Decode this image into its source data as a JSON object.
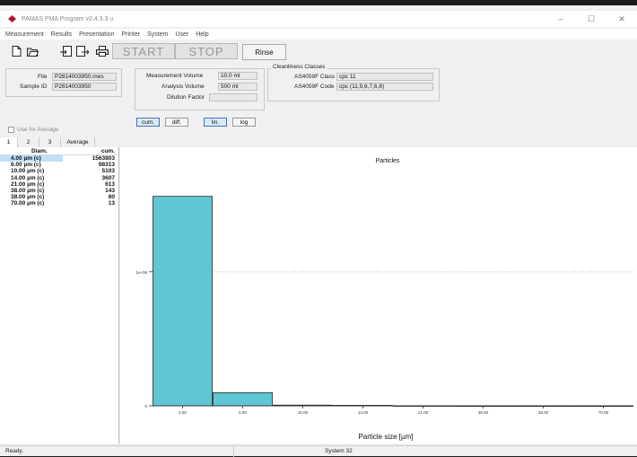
{
  "window": {
    "title": "PAMAS PMA Program v2.4.3.3 u",
    "controls": [
      "–",
      "☐",
      "✕"
    ]
  },
  "menu": [
    "Measurement",
    "Results",
    "Presentation",
    "Printer",
    "System",
    "User",
    "Help"
  ],
  "toolbar": {
    "icons": [
      "new-document-icon",
      "open-folder-icon",
      "export-icon",
      "import-icon",
      "print-icon"
    ],
    "start_label": "START",
    "stop_label": "STOP",
    "rinse_label": "Rinse"
  },
  "info": {
    "file_label": "File",
    "file_value": "P2814003950.mes",
    "sample_label": "Sample ID",
    "sample_value": "P2814003950",
    "meas_volume_label": "Measurement Volume",
    "meas_volume_value": "10.0 ml",
    "analysis_volume_label": "Analysis Volume",
    "analysis_volume_value": "500 ml",
    "dilution_label": "Dilution Factor",
    "dilution_value": "",
    "cleanliness_label": "Cleanliness Classes",
    "as_class_label": "AS4059F Class",
    "as_class_value": "cpc 11",
    "as_code_label": "AS4059F Code",
    "as_code_value": "cpc (11,9,6,7,6,8)",
    "buttons": {
      "cum": "cum.",
      "diff": "diff.",
      "lin": "lin.",
      "log": "log"
    },
    "use_average_label": "Use for Average"
  },
  "tabs": [
    "1",
    "2",
    "3",
    "Average"
  ],
  "table": {
    "headers": [
      "Diam.",
      "cum."
    ],
    "rows": [
      [
        "4.00 µm (c)",
        "1563803"
      ],
      [
        "6.00 µm (c)",
        "98313"
      ],
      [
        "10.00 µm (c)",
        "5103"
      ],
      [
        "14.00 µm (c)",
        "3607"
      ],
      [
        "21.00 µm (c)",
        "613"
      ],
      [
        "38.00 µm (c)",
        "143"
      ],
      [
        "38.00 µm (c)",
        "80"
      ],
      [
        "70.00 µm (c)",
        "13"
      ]
    ]
  },
  "chart_data": {
    "type": "bar",
    "title": "Particles",
    "xlabel": "Particle size [µm]",
    "ylabel": "",
    "categories": [
      "4.00",
      "6.00",
      "10.00",
      "14.00",
      "21.00",
      "38.00",
      "38.00",
      "70.00"
    ],
    "values": [
      1563803,
      98313,
      5103,
      3607,
      613,
      143,
      80,
      13
    ],
    "ylim": [
      0,
      1850000
    ],
    "ytick_labels": [
      {
        "value": 0,
        "label": "0"
      },
      {
        "value": 1000000,
        "label": "1e+06"
      }
    ],
    "bar_color": "#5ec7d3",
    "grid": false
  },
  "status": {
    "left": "Ready.",
    "middle": "System 32"
  }
}
